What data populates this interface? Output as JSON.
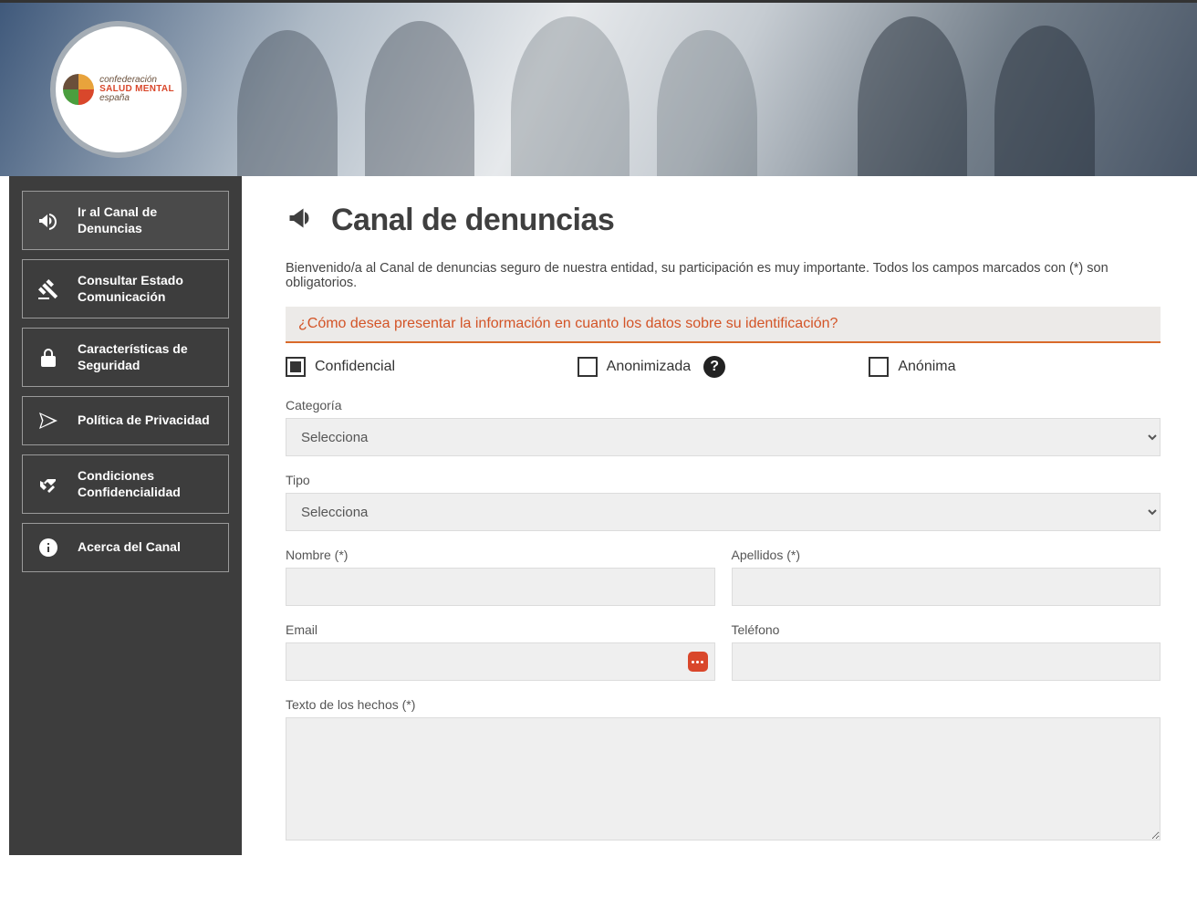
{
  "logo": {
    "line1": "confederación",
    "line2": "SALUD MENTAL",
    "line3": "españa"
  },
  "sidebar": {
    "items": [
      {
        "id": "canal",
        "label": "Ir al Canal de Denuncias"
      },
      {
        "id": "estado",
        "label": "Consultar Estado Comunicación"
      },
      {
        "id": "seguridad",
        "label": "Características de Seguridad"
      },
      {
        "id": "privacidad",
        "label": "Política de Privacidad"
      },
      {
        "id": "condiciones",
        "label": "Condiciones Confidencialidad"
      },
      {
        "id": "acerca",
        "label": "Acerca del Canal"
      }
    ]
  },
  "page": {
    "title": "Canal de denuncias",
    "intro": "Bienvenido/a al Canal de denuncias seguro de nuestra entidad, su participación es muy importante. Todos los campos marcados con (*) son obligatorios.",
    "question": "¿Cómo desea presentar la información en cuanto los datos sobre su identificación?"
  },
  "identification": {
    "options": {
      "confidencial": "Confidencial",
      "anonimizada": "Anonimizada",
      "anonima": "Anónima"
    },
    "selected": "confidencial"
  },
  "form": {
    "categoria": {
      "label": "Categoría",
      "placeholder": "Selecciona"
    },
    "tipo": {
      "label": "Tipo",
      "placeholder": "Selecciona"
    },
    "nombre": {
      "label": "Nombre (*)"
    },
    "apellidos": {
      "label": "Apellidos (*)"
    },
    "email": {
      "label": "Email"
    },
    "telefono": {
      "label": "Teléfono"
    },
    "texto": {
      "label": "Texto de los hechos (*)"
    }
  }
}
